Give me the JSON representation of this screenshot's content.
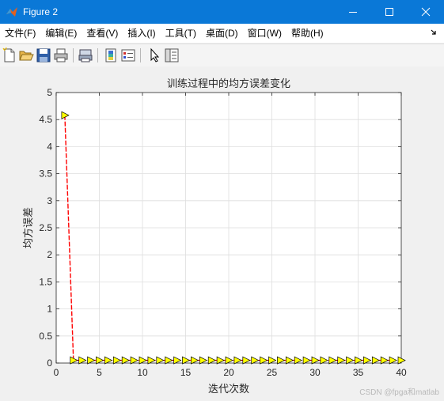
{
  "window": {
    "title": "Figure 2",
    "accent_color": "#0a78d7"
  },
  "menu": {
    "items": [
      {
        "label": "文件(F)",
        "name": "menu-file"
      },
      {
        "label": "编辑(E)",
        "name": "menu-edit"
      },
      {
        "label": "查看(V)",
        "name": "menu-view"
      },
      {
        "label": "插入(I)",
        "name": "menu-insert"
      },
      {
        "label": "工具(T)",
        "name": "menu-tools"
      },
      {
        "label": "桌面(D)",
        "name": "menu-desktop"
      },
      {
        "label": "窗口(W)",
        "name": "menu-window"
      },
      {
        "label": "帮助(H)",
        "name": "menu-help"
      }
    ]
  },
  "toolbar": {
    "icons": [
      "new-figure-icon",
      "open-file-icon",
      "save-icon",
      "print-icon",
      "print-preview-icon",
      "colorbar-icon",
      "legend-icon",
      "pointer-icon",
      "property-inspector-icon"
    ]
  },
  "chart_data": {
    "type": "line",
    "title": "训练过程中的均方误差变化",
    "xlabel": "迭代次数",
    "ylabel": "均方误差",
    "xlim": [
      0,
      40
    ],
    "ylim": [
      0,
      5
    ],
    "xticks": [
      0,
      5,
      10,
      15,
      20,
      25,
      30,
      35,
      40
    ],
    "yticks": [
      0,
      0.5,
      1,
      1.5,
      2,
      2.5,
      3,
      3.5,
      4,
      4.5,
      5
    ],
    "grid": true,
    "series": [
      {
        "line_color": "#ff0000",
        "marker": "triangle-right",
        "marker_color": "#ffff00",
        "x": [
          1,
          2,
          3,
          4,
          5,
          6,
          7,
          8,
          9,
          10,
          11,
          12,
          13,
          14,
          15,
          16,
          17,
          18,
          19,
          20,
          21,
          22,
          23,
          24,
          25,
          26,
          27,
          28,
          29,
          30,
          31,
          32,
          33,
          34,
          35,
          36,
          37,
          38,
          39,
          40
        ],
        "y": [
          4.58,
          0.05,
          0.05,
          0.05,
          0.05,
          0.05,
          0.05,
          0.05,
          0.05,
          0.05,
          0.05,
          0.05,
          0.05,
          0.05,
          0.05,
          0.05,
          0.05,
          0.05,
          0.05,
          0.05,
          0.05,
          0.05,
          0.05,
          0.05,
          0.05,
          0.05,
          0.05,
          0.05,
          0.05,
          0.05,
          0.05,
          0.05,
          0.05,
          0.05,
          0.05,
          0.05,
          0.05,
          0.05,
          0.05,
          0.05
        ]
      }
    ]
  },
  "watermark": "CSDN @fpga和matlab"
}
